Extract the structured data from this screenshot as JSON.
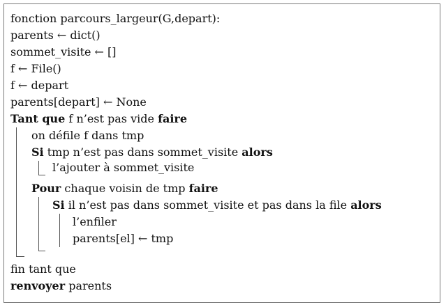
{
  "algorithm": {
    "header": "fonction parcours_largeur(G,depart):",
    "init": [
      "parents ← dict()",
      "sommet_visite ← []",
      "f ← File()",
      "f ← depart",
      "parents[depart] ← None"
    ],
    "while": {
      "keyword": "Tant que",
      "condition": " f n’est pas vide ",
      "do": "faire"
    },
    "dequeue": "on défile f dans tmp",
    "if1": {
      "keyword": "Si",
      "condition": " tmp n’est pas dans sommet_visite ",
      "then": "alors"
    },
    "if1_body": "l’ajouter à sommet_visite",
    "for": {
      "keyword": "Pour",
      "condition": " chaque voisin de tmp ",
      "do": "faire"
    },
    "if2": {
      "keyword": "Si",
      "condition": " il n’est pas dans sommet_visite et pas dans la file ",
      "then": "alors"
    },
    "if2_body": [
      "l’enfiler",
      "parents[el] ← tmp"
    ],
    "end_while": "fin tant que",
    "return": {
      "keyword": "renvoyer",
      "value": " parents"
    }
  }
}
